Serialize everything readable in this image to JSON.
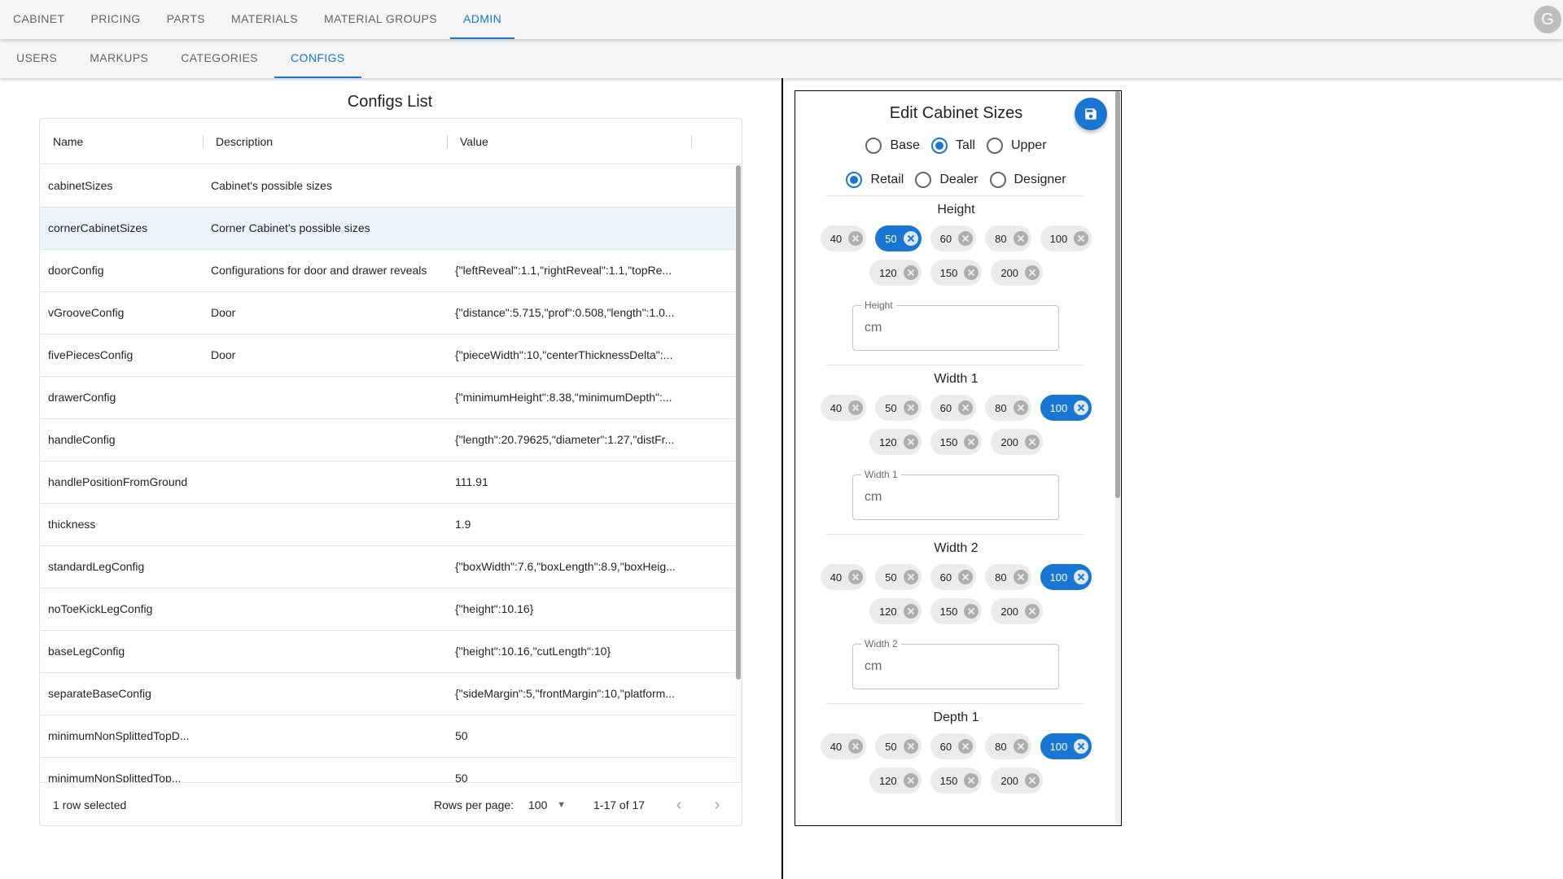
{
  "nav": {
    "tabs": [
      "CABINET",
      "PRICING",
      "PARTS",
      "MATERIALS",
      "MATERIAL GROUPS",
      "ADMIN"
    ],
    "active_tab": "ADMIN",
    "avatar_letter": "G"
  },
  "subnav": {
    "tabs": [
      "USERS",
      "MARKUPS",
      "CATEGORIES",
      "CONFIGS"
    ],
    "active_tab": "CONFIGS"
  },
  "configs": {
    "title": "Configs List",
    "columns": {
      "name": "Name",
      "description": "Description",
      "value": "Value"
    },
    "rows": [
      {
        "name": "cabinetSizes",
        "description": "Cabinet's possible sizes",
        "value": "",
        "selected": false
      },
      {
        "name": "cornerCabinetSizes",
        "description": "Corner Cabinet's possible sizes",
        "value": "",
        "selected": true
      },
      {
        "name": "doorConfig",
        "description": "Configurations for door and drawer reveals",
        "value": "{\"leftReveal\":1.1,\"rightReveal\":1.1,\"topRe...",
        "selected": false
      },
      {
        "name": "vGrooveConfig",
        "description": "Door",
        "value": "{\"distance\":5.715,\"prof\":0.508,\"length\":1.0...",
        "selected": false
      },
      {
        "name": "fivePiecesConfig",
        "description": "Door",
        "value": "{\"pieceWidth\":10,\"centerThicknessDelta\":...",
        "selected": false
      },
      {
        "name": "drawerConfig",
        "description": "",
        "value": "{\"minimumHeight\":8.38,\"minimumDepth\":...",
        "selected": false
      },
      {
        "name": "handleConfig",
        "description": "",
        "value": "{\"length\":20.79625,\"diameter\":1.27,\"distFr...",
        "selected": false
      },
      {
        "name": "handlePositionFromGround",
        "description": "",
        "value": "111.91",
        "selected": false
      },
      {
        "name": "thickness",
        "description": "",
        "value": "1.9",
        "selected": false
      },
      {
        "name": "standardLegConfig",
        "description": "",
        "value": "{\"boxWidth\":7.6,\"boxLength\":8.9,\"boxHeig...",
        "selected": false
      },
      {
        "name": "noToeKickLegConfig",
        "description": "",
        "value": "{\"height\":10.16}",
        "selected": false
      },
      {
        "name": "baseLegConfig",
        "description": "",
        "value": "{\"height\":10.16,\"cutLength\":10}",
        "selected": false
      },
      {
        "name": "separateBaseConfig",
        "description": "",
        "value": "{\"sideMargin\":5,\"frontMargin\":10,\"platform...",
        "selected": false
      },
      {
        "name": "minimumNonSplittedTopD...",
        "description": "",
        "value": "50",
        "selected": false
      },
      {
        "name": "minimumNonSplittedTop...",
        "description": "",
        "value": "50",
        "selected": false
      }
    ],
    "footer": {
      "selection": "1 row selected",
      "rows_per_page_label": "Rows per page:",
      "rows_per_page": "100",
      "range": "1-17 of 17"
    }
  },
  "editor": {
    "title": "Edit Cabinet Sizes",
    "types": [
      {
        "label": "Base",
        "checked": false
      },
      {
        "label": "Tall",
        "checked": true
      },
      {
        "label": "Upper",
        "checked": false
      }
    ],
    "roles": [
      {
        "label": "Retail",
        "checked": true
      },
      {
        "label": "Dealer",
        "checked": false
      },
      {
        "label": "Designer",
        "checked": false
      }
    ],
    "sections": [
      {
        "title": "Height",
        "chips": [
          "40",
          "50",
          "60",
          "80",
          "100",
          "120",
          "150",
          "200"
        ],
        "selected": "50",
        "field_label": "Height",
        "field_placeholder": "cm"
      },
      {
        "title": "Width 1",
        "chips": [
          "40",
          "50",
          "60",
          "80",
          "100",
          "120",
          "150",
          "200"
        ],
        "selected": "100",
        "field_label": "Width 1",
        "field_placeholder": "cm"
      },
      {
        "title": "Width 2",
        "chips": [
          "40",
          "50",
          "60",
          "80",
          "100",
          "120",
          "150",
          "200"
        ],
        "selected": "100",
        "field_label": "Width 2",
        "field_placeholder": "cm"
      },
      {
        "title": "Depth 1",
        "chips": [
          "40",
          "50",
          "60",
          "80",
          "100",
          "120",
          "150",
          "200"
        ],
        "selected": "100",
        "field_label": "",
        "field_placeholder": ""
      }
    ]
  },
  "icons": {
    "save": "floppy-disk-icon",
    "prev": "chevron-left-icon",
    "next": "chevron-right-icon",
    "chip_delete": "cancel-circle-icon",
    "dropdown": "caret-down-icon"
  },
  "colors": {
    "accent": "#1976d2",
    "nav_bg": "#f5f5f5",
    "chip_bg": "#ebebeb",
    "selected_row": "#e8f1fb"
  }
}
